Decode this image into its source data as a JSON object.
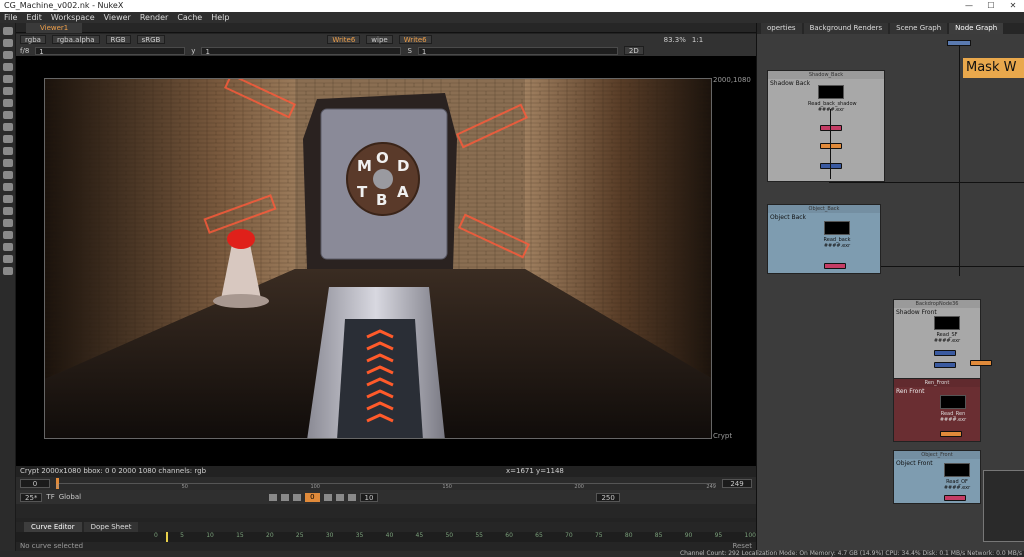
{
  "window": {
    "title": "CG_Machine_v002.nk - NukeX",
    "controls": [
      "—",
      "☐",
      "✕"
    ]
  },
  "menu": [
    "File",
    "Edit",
    "Workspace",
    "Viewer",
    "Render",
    "Cache",
    "Help"
  ],
  "viewer": {
    "tab": "Viewer1",
    "row1": {
      "channels": "rgba",
      "alpha": "rgba.alpha",
      "colorspace": "RGB",
      "display": "sRGB",
      "input_a": "Write6",
      "wipe": "wipe",
      "input_b": "Write6",
      "zoom": "83.3%",
      "ratio": "1:1"
    },
    "row2": {
      "fstop": "f/8",
      "fstop_val": "1",
      "y_label": "y",
      "y_val": "1",
      "s_label": "S",
      "s_val": "1",
      "mode": "2D"
    },
    "format_label": "2000,1080",
    "crypt_label": "Crypt",
    "status_left": "Crypt 2000x1080  bbox: 0 0 2000 1080 channels: rgb",
    "status_xy": "x=1671 y=1148"
  },
  "logo_letters": [
    "M",
    "O",
    "D",
    "T",
    "B",
    "A"
  ],
  "playback": {
    "start": "0",
    "end": "249",
    "fps": "25*",
    "tf": "TF",
    "global": "Global",
    "current": "0",
    "step": "10",
    "total": "250",
    "ruler": [
      "0",
      "50",
      "100",
      "150",
      "200",
      "249"
    ]
  },
  "bottom_tabs": [
    "Curve Editor",
    "Dope Sheet"
  ],
  "curve": {
    "status": "No curve selected",
    "reset": "Reset",
    "ruler": [
      "0",
      "5",
      "10",
      "15",
      "20",
      "25",
      "30",
      "35",
      "40",
      "45",
      "50",
      "55",
      "60",
      "65",
      "70",
      "75",
      "80",
      "85",
      "90",
      "95",
      "100"
    ]
  },
  "statusbar": "Channel Count: 292 Localization Mode: On Memory: 4.7 GB (14.9%) CPU: 34.4% Disk: 0.1 MB/s Network: 0.0 MB/s",
  "right_tabs": [
    "operties",
    "Background Renders",
    "Scene Graph",
    "Node Graph"
  ],
  "graph": {
    "mask_label": "Mask W",
    "backdrops": [
      {
        "header": "Shadow_Back",
        "label": "Shadow Back",
        "color": "#a8a8a8",
        "read": "Read_back_shadow",
        "sub": "####.exr"
      },
      {
        "header": "Object_Back",
        "label": "Object Back",
        "color": "#7e9cb0",
        "read": "Read_back",
        "sub": "####.exr"
      },
      {
        "header": "BackdropNode36",
        "label": "Shadow Front",
        "color": "#a8a8a8",
        "read": "Read_SF",
        "sub": "####.exr"
      },
      {
        "header": "Ren_Front",
        "label": "Ren Front",
        "color": "#6a2e32",
        "read": "Read_Ren",
        "sub": "####.exr"
      },
      {
        "header": "Object_Front",
        "label": "Object Front",
        "color": "#7e9cb0",
        "read": "Read_OF",
        "sub": "####.exr"
      }
    ]
  },
  "colors": {
    "accent": "#f0a04a",
    "blur_node": "#e08a3a",
    "merge_node": "#3a5aa0",
    "grade_node": "#c43c64"
  }
}
